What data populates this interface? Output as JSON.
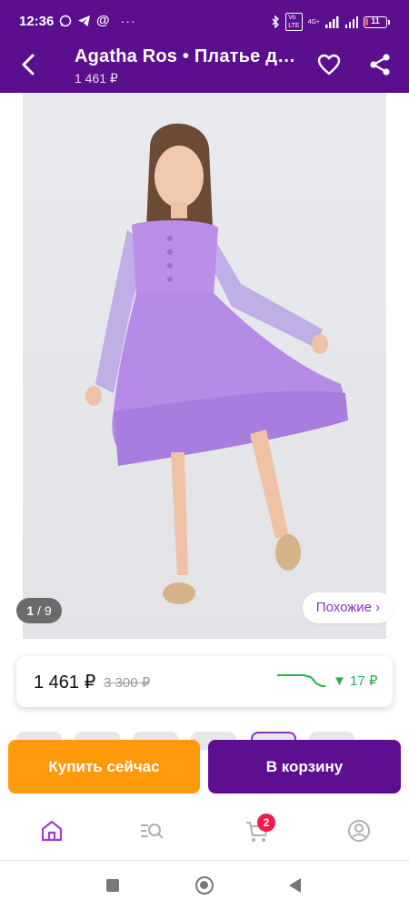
{
  "status_bar": {
    "time": "12:36",
    "network": "4G+",
    "battery": "11"
  },
  "header": {
    "title": "Agatha Ros • Платье детское",
    "price": "1 461 ₽"
  },
  "gallery": {
    "counter_current": "1",
    "counter_total": " / 9",
    "similar_label": "Похожие ›"
  },
  "price_card": {
    "current_price": "1 461 ₽",
    "old_price": "3 300 ₽",
    "price_drop": "▼ 17 ₽"
  },
  "actions": {
    "buy_now": "Купить сейчас",
    "add_to_cart": "В корзину"
  },
  "bottom_nav": {
    "cart_count": "2",
    "items": [
      "home-icon",
      "catalog-search-icon",
      "cart-icon",
      "profile-icon"
    ]
  },
  "colors": {
    "brand_purple": "#5b0f8e",
    "accent_purple": "#8d2fc2",
    "orange": "#ff9a0c",
    "green": "#22b14c",
    "badge_red": "#f5194f"
  }
}
